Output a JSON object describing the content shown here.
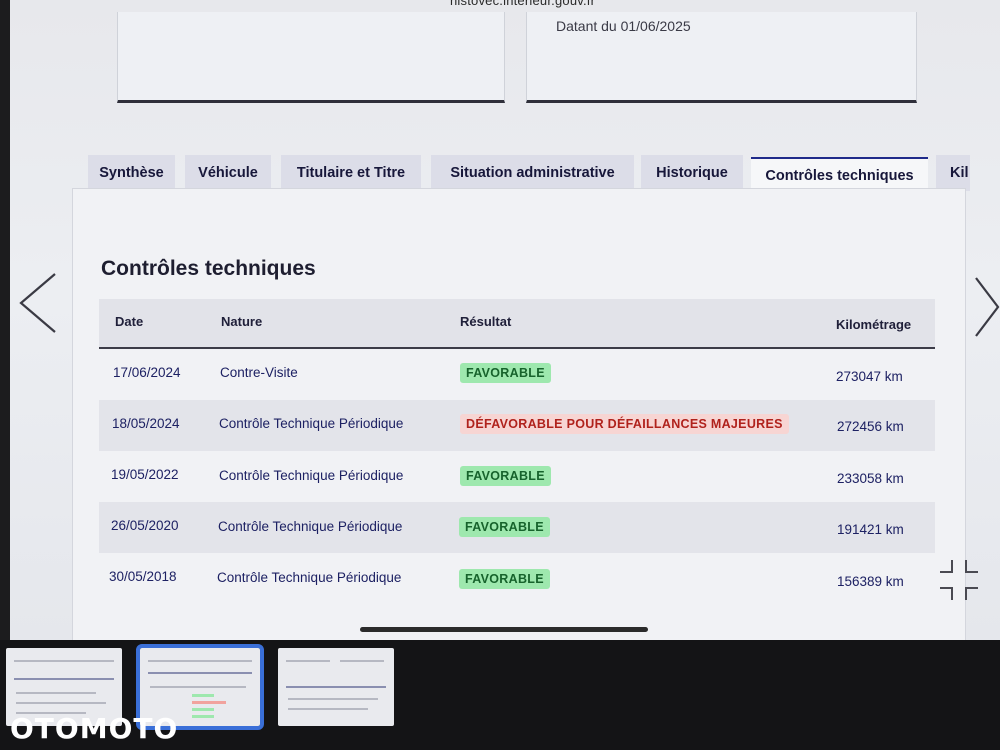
{
  "browser": {
    "url": "histovec.interieur.gouv.fr"
  },
  "top_cards": {
    "right_text": "Datant du 01/06/2025"
  },
  "tabs": [
    {
      "label": "Synthèse"
    },
    {
      "label": "Véhicule"
    },
    {
      "label": "Titulaire et Titre"
    },
    {
      "label": "Situation administrative"
    },
    {
      "label": "Historique"
    },
    {
      "label": "Contrôles techniques",
      "active": true
    },
    {
      "label": "Kil"
    }
  ],
  "panel": {
    "title": "Contrôles techniques",
    "columns": {
      "date": "Date",
      "nature": "Nature",
      "resultat": "Résultat",
      "kilometrage": "Kilométrage"
    },
    "rows": [
      {
        "date": "17/06/2024",
        "nature": "Contre-Visite",
        "resultat": "FAVORABLE",
        "kilometrage": "273047 km"
      },
      {
        "date": "18/05/2024",
        "nature": "Contrôle Technique Périodique",
        "resultat": "DÉFAVORABLE POUR DÉFAILLANCES MAJEURES",
        "kilometrage": "272456 km"
      },
      {
        "date": "19/05/2022",
        "nature": "Contrôle Technique Périodique",
        "resultat": "FAVORABLE",
        "kilometrage": "233058 km"
      },
      {
        "date": "26/05/2020",
        "nature": "Contrôle Technique Périodique",
        "resultat": "FAVORABLE",
        "kilometrage": "191421 km"
      },
      {
        "date": "30/05/2018",
        "nature": "Contrôle Technique Périodique",
        "resultat": "FAVORABLE",
        "kilometrage": "156389 km"
      }
    ]
  },
  "gallery": {
    "watermark": "OTOMOTO"
  },
  "colors": {
    "favorable_bg": "#9ee8ae",
    "defavorable_bg": "#f7d5d3",
    "tab_active_border": "#1f2a8a",
    "thumb_selected": "#3a6fd8"
  }
}
